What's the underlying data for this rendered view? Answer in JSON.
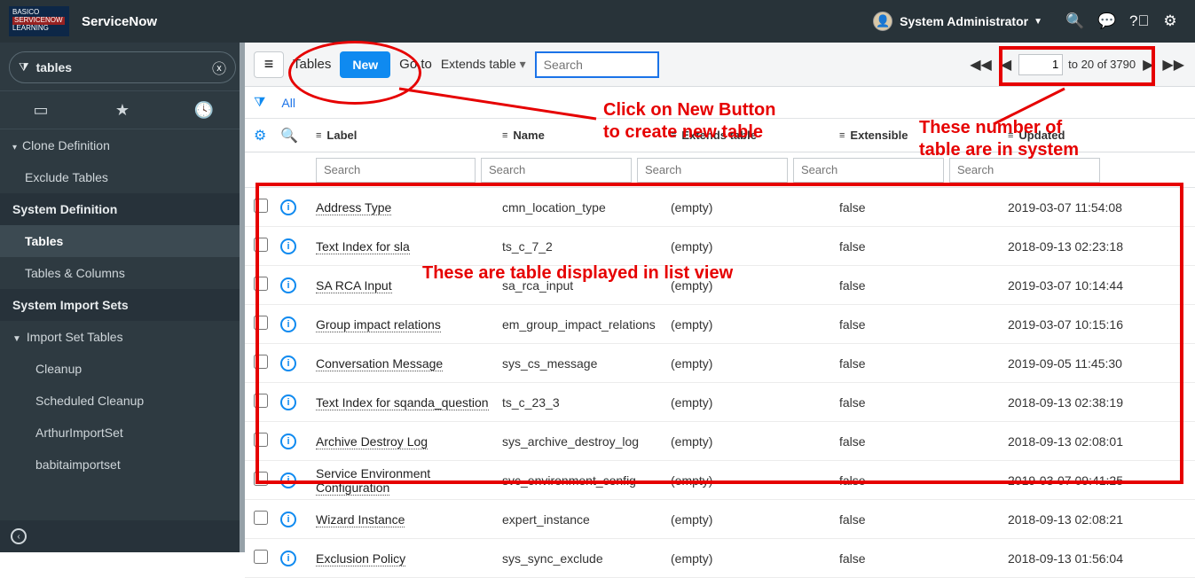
{
  "top": {
    "brand": "ServiceNow",
    "logo_line1": "BASICO",
    "logo_line2": "SERVICENOW",
    "logo_line3": "LEARNING",
    "user": "System Administrator"
  },
  "nav": {
    "filter_text": "tables",
    "items": [
      {
        "label": "Clone Definition",
        "level": 1,
        "tri": "▾"
      },
      {
        "label": "Exclude Tables",
        "level": 2
      },
      {
        "label": "System Definition",
        "level": 0,
        "section": true
      },
      {
        "label": "Tables",
        "level": 2,
        "selected": true
      },
      {
        "label": "Tables & Columns",
        "level": 2
      },
      {
        "label": "System Import Sets",
        "level": 0,
        "section": true
      },
      {
        "label": "Import Set Tables",
        "level": 1,
        "tri": "▼"
      },
      {
        "label": "Cleanup",
        "level": 3
      },
      {
        "label": "Scheduled Cleanup",
        "level": 3
      },
      {
        "label": "ArthurImportSet",
        "level": 3
      },
      {
        "label": "babitaimportset",
        "level": 3
      }
    ]
  },
  "toolbar": {
    "title": "Tables",
    "new_label": "New",
    "goto_label": "Go to",
    "extends_label": "Extends table",
    "search_placeholder": "Search",
    "page_from": "1",
    "page_range": "to 20 of 3790"
  },
  "filter": {
    "all": "All"
  },
  "columns": {
    "label": "Label",
    "name": "Name",
    "extends": "Extends table",
    "extensible": "Extensible",
    "updated": "Updated",
    "search_ph": "Search"
  },
  "rows": [
    {
      "label": "Address Type",
      "name": "cmn_location_type",
      "extends": "(empty)",
      "extensible": "false",
      "updated": "2019-03-07 11:54:08"
    },
    {
      "label": "Text Index for sla",
      "name": "ts_c_7_2",
      "extends": "(empty)",
      "extensible": "false",
      "updated": "2018-09-13 02:23:18"
    },
    {
      "label": "SA RCA Input",
      "name": "sa_rca_input",
      "extends": "(empty)",
      "extensible": "false",
      "updated": "2019-03-07 10:14:44"
    },
    {
      "label": "Group impact relations",
      "name": "em_group_impact_relations",
      "extends": "(empty)",
      "extensible": "false",
      "updated": "2019-03-07 10:15:16"
    },
    {
      "label": "Conversation Message",
      "name": "sys_cs_message",
      "extends": "(empty)",
      "extensible": "false",
      "updated": "2019-09-05 11:45:30"
    },
    {
      "label": "Text Index for sqanda_question",
      "name": "ts_c_23_3",
      "extends": "(empty)",
      "extensible": "false",
      "updated": "2018-09-13 02:38:19"
    },
    {
      "label": "Archive Destroy Log",
      "name": "sys_archive_destroy_log",
      "extends": "(empty)",
      "extensible": "false",
      "updated": "2018-09-13 02:08:01"
    },
    {
      "label": "Service Environment Configuration",
      "name": "svc_environment_config",
      "extends": "(empty)",
      "extensible": "false",
      "updated": "2019-03-07 09:41:25"
    },
    {
      "label": "Wizard Instance",
      "name": "expert_instance",
      "extends": "(empty)",
      "extensible": "false",
      "updated": "2018-09-13 02:08:21"
    },
    {
      "label": "Exclusion Policy",
      "name": "sys_sync_exclude",
      "extends": "(empty)",
      "extensible": "false",
      "updated": "2018-09-13 01:56:04"
    }
  ],
  "annotations": {
    "a1": "Click on New Button\nto create new table",
    "a2": "These number of\ntable are in system",
    "a3": "These are table displayed in list view"
  }
}
